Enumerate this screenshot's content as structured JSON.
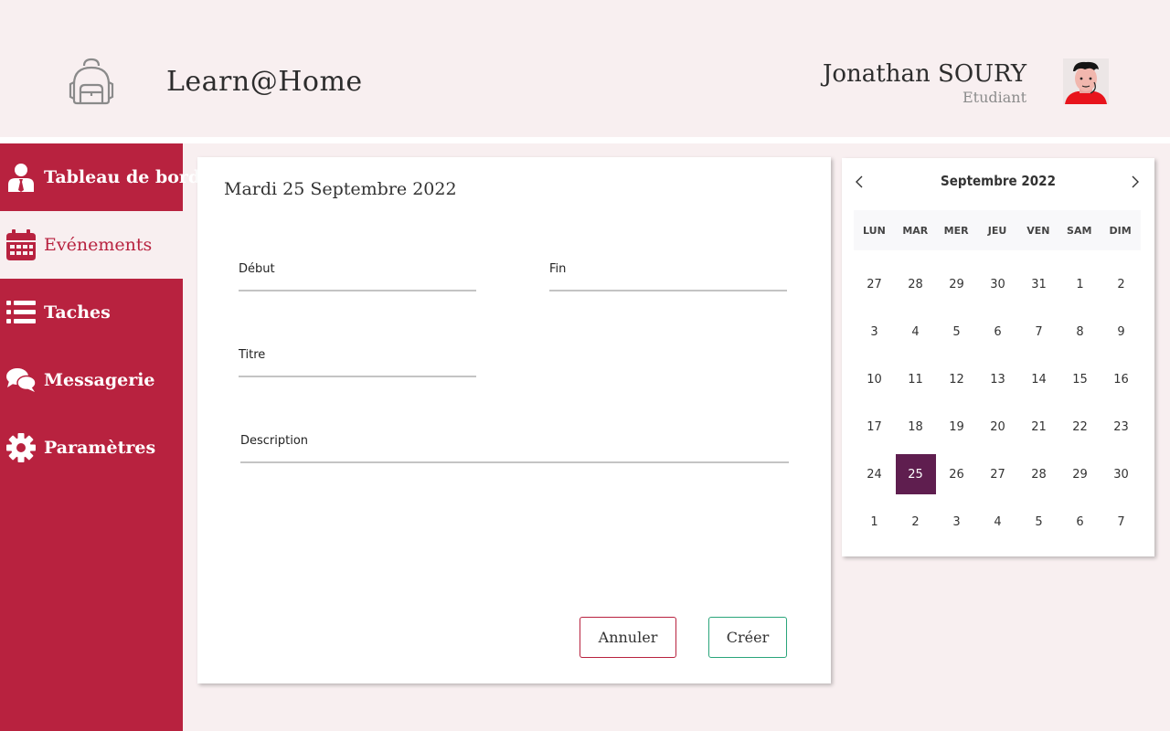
{
  "header": {
    "app_title": "Learn@Home",
    "user_name": "Jonathan SOURY",
    "user_role": "Etudiant"
  },
  "sidebar": {
    "items": [
      {
        "label": "Tableau de bord",
        "icon": "user-tie-icon",
        "active": false
      },
      {
        "label": "Evénements",
        "icon": "calendar-icon",
        "active": true
      },
      {
        "label": "Taches",
        "icon": "list-icon",
        "active": false
      },
      {
        "label": "Messagerie",
        "icon": "chat-icon",
        "active": false
      },
      {
        "label": "Paramètres",
        "icon": "gear-icon",
        "active": false
      }
    ]
  },
  "form": {
    "date_title": "Mardi 25 Septembre 2022",
    "start_label": "Début",
    "start_value": "",
    "end_label": "Fin",
    "end_value": "",
    "title_label": "Titre",
    "title_value": "",
    "description_label": "Description",
    "description_value": "",
    "cancel_label": "Annuler",
    "create_label": "Créer"
  },
  "calendar": {
    "month_label": "Septembre 2022",
    "weekdays": [
      "LUN",
      "MAR",
      "MER",
      "JEU",
      "VEN",
      "SAM",
      "DIM"
    ],
    "days": [
      "27",
      "28",
      "29",
      "30",
      "31",
      "1",
      "2",
      "3",
      "4",
      "5",
      "6",
      "7",
      "8",
      "9",
      "10",
      "11",
      "12",
      "13",
      "14",
      "15",
      "16",
      "17",
      "18",
      "19",
      "20",
      "21",
      "22",
      "23",
      "24",
      "25",
      "26",
      "27",
      "28",
      "29",
      "30",
      "1",
      "2",
      "3",
      "4",
      "5",
      "6",
      "7"
    ],
    "selected_index": 29
  },
  "colors": {
    "primary": "#b8223f",
    "background": "#f8eff0",
    "selected_day": "#5f1e4f",
    "create_border": "#2aa57a"
  }
}
